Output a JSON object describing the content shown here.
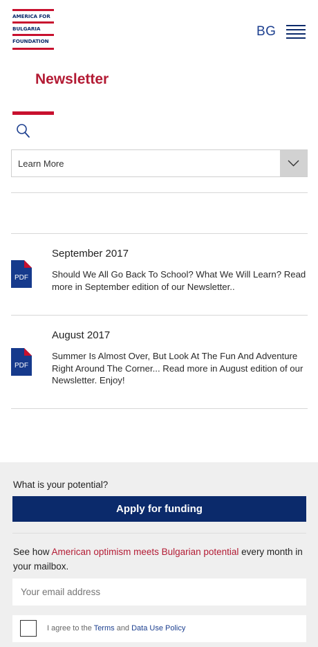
{
  "header": {
    "logo_lines": [
      "AMERICA FOR",
      "BULGARIA",
      "FOUNDATION"
    ],
    "language": "BG",
    "menu_icon": "hamburger-menu-icon"
  },
  "page": {
    "title": "Newsletter",
    "search_icon": "search-icon"
  },
  "filter": {
    "selected": "Learn More",
    "arrow_icon": "chevron-down-icon"
  },
  "newsletters": [
    {
      "date": "September 2017",
      "description": "Should We All Go Back To School? What We Will Learn? Read more in September edition of our Newsletter..",
      "file_type": "PDF"
    },
    {
      "date": "August 2017",
      "description": "Summer Is Almost Over, But Look At The Fun And Adventure Right Around The Corner... Read more in August edition of our Newsletter. Enjoy!",
      "file_type": "PDF"
    }
  ],
  "footer": {
    "question": "What is your potential?",
    "apply_label": "Apply for funding",
    "subscribe_prefix": "See how ",
    "subscribe_highlight": "American optimism meets Bulgarian potential",
    "subscribe_suffix": "  every month in your mailbox.",
    "email_placeholder": "Your email address",
    "agree_prefix": "I agree to the ",
    "terms_label": "Terms",
    "agree_and": " and ",
    "policy_label": "Data Use Policy"
  },
  "colors": {
    "brand_red": "#c8102e",
    "brand_navy": "#0b2a6b",
    "pdf_icon": "#163a8c"
  }
}
